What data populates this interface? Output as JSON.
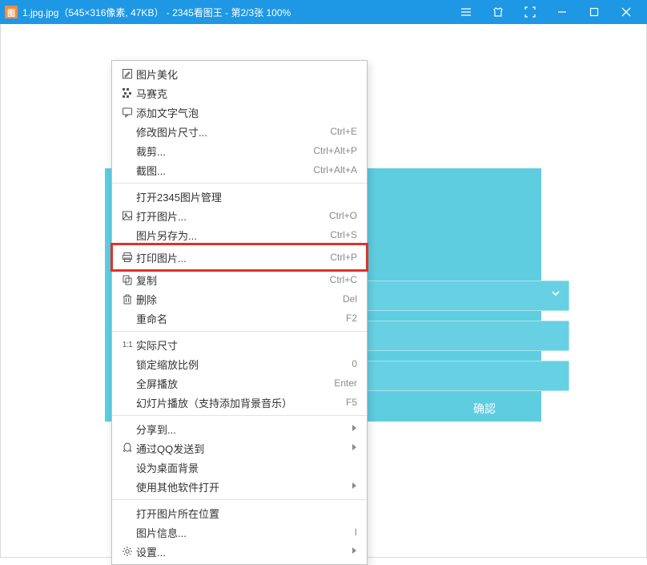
{
  "titlebar": {
    "app_icon_letter": "图",
    "title": "1.jpg.jpg（545×316像素, 47KB） - 2345看图王 - 第2/3张 100%"
  },
  "image_panel": {
    "confirm": "确認"
  },
  "menu": {
    "groups": [
      [
        {
          "icon": "edit-icon",
          "label": "图片美化"
        },
        {
          "icon": "mosaic-icon",
          "label": "马赛克"
        },
        {
          "icon": "bubble-icon",
          "label": "添加文字气泡"
        },
        {
          "icon": "",
          "label": "修改图片尺寸...",
          "accel": "Ctrl+E"
        },
        {
          "icon": "",
          "label": "裁剪...",
          "accel": "Ctrl+Alt+P"
        },
        {
          "icon": "",
          "label": "截图...",
          "accel": "Ctrl+Alt+A"
        }
      ],
      [
        {
          "icon": "",
          "label": "打开2345图片管理"
        },
        {
          "icon": "image-icon",
          "label": "打开图片...",
          "accel": "Ctrl+O"
        },
        {
          "icon": "",
          "label": "图片另存为...",
          "accel": "Ctrl+S"
        },
        {
          "icon": "print-icon",
          "label": "打印图片...",
          "accel": "Ctrl+P",
          "highlight": true
        },
        {
          "icon": "copy-icon",
          "label": "复制",
          "accel": "Ctrl+C"
        },
        {
          "icon": "trash-icon",
          "label": "删除",
          "accel": "Del"
        },
        {
          "icon": "",
          "label": "重命名",
          "accel": "F2"
        }
      ],
      [
        {
          "icon": "one-one-icon",
          "label": "实际尺寸"
        },
        {
          "icon": "",
          "label": "锁定缩放比例",
          "accel": "0"
        },
        {
          "icon": "",
          "label": "全屏播放",
          "accel": "Enter"
        },
        {
          "icon": "",
          "label": "幻灯片播放（支持添加背景音乐）",
          "accel": "F5"
        }
      ],
      [
        {
          "icon": "",
          "label": "分享到...",
          "submenu": true
        },
        {
          "icon": "qq-icon",
          "label": "通过QQ发送到",
          "submenu": true
        },
        {
          "icon": "",
          "label": "设为桌面背景"
        },
        {
          "icon": "",
          "label": "使用其他软件打开",
          "submenu": true
        }
      ],
      [
        {
          "icon": "",
          "label": "打开图片所在位置"
        },
        {
          "icon": "",
          "label": "图片信息...",
          "accel": "I"
        },
        {
          "icon": "gear-icon",
          "label": "设置...",
          "submenu": true
        }
      ]
    ]
  }
}
